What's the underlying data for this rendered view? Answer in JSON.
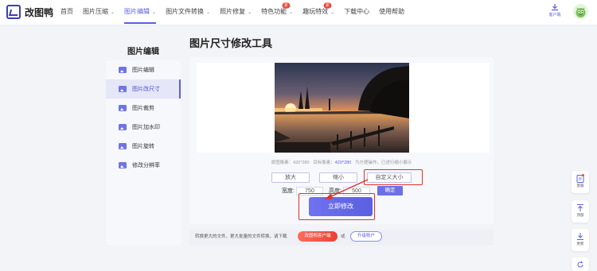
{
  "header": {
    "logo_text": "改图鸭",
    "nav": [
      {
        "label": "首页"
      },
      {
        "label": "图片压缩",
        "caret": "⌄"
      },
      {
        "label": "图片编辑",
        "caret": "⌄",
        "active": true
      },
      {
        "label": "图片文件转换",
        "caret": "⌄"
      },
      {
        "label": "照片修复",
        "caret": "⌄"
      },
      {
        "label": "特色功能",
        "caret": "⌄",
        "badge": "新"
      },
      {
        "label": "趣玩特效",
        "caret": "⌄",
        "badge": "新"
      },
      {
        "label": "下载中心"
      },
      {
        "label": "使用帮助"
      }
    ],
    "client_label": "客户端"
  },
  "sidebar": {
    "title": "图片编辑",
    "items": [
      {
        "label": "图片编辑"
      },
      {
        "label": "图片改尺寸",
        "active": true
      },
      {
        "label": "图片裁剪"
      },
      {
        "label": "图片加水印"
      },
      {
        "label": "图片旋转"
      },
      {
        "label": "修改分辨率"
      }
    ]
  },
  "main": {
    "title": "图片尺寸修改工具",
    "info": {
      "orig_label": "原图像素：",
      "orig_value": "420*280",
      "target_label": "目标像素：",
      "target_value": "420*280",
      "note": "为方便操作，已进行缩小展示"
    },
    "buttons": {
      "enlarge": "放大",
      "shrink": "缩小",
      "custom": "自定义大小"
    },
    "width_label": "宽度:",
    "width_value": "750",
    "height_label": "高度:",
    "height_value": "500",
    "confirm": "确定",
    "apply": "立即修改"
  },
  "bottom": {
    "text": "转换更大的文件、更大批量的文件转换，请下载",
    "client_btn": "改图鸭客户端",
    "or": "或",
    "upgrade": "升级账户"
  },
  "float": {
    "service": "客服",
    "top": "顶部",
    "download": "更新"
  },
  "colors": {
    "accent": "#5b5fe0",
    "highlight": "#e0322b"
  }
}
